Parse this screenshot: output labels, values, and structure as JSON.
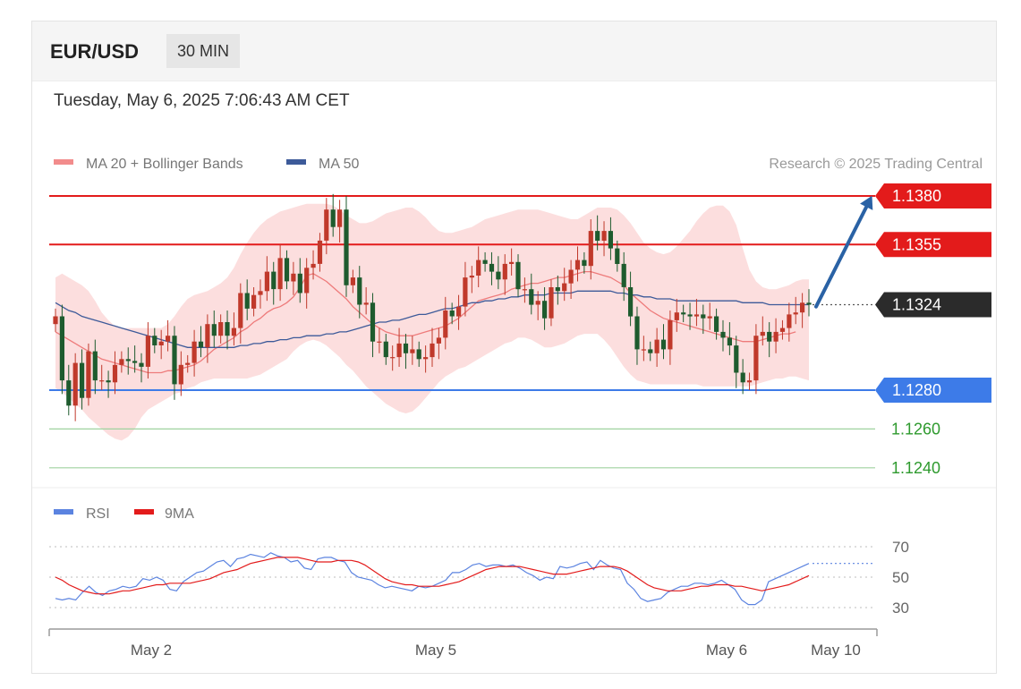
{
  "header": {
    "pair": "EUR/USD",
    "interval": "30 MIN"
  },
  "timestamp": "Tuesday, May 6, 2025 7:06:43 AM CET",
  "legend": {
    "ma20_label": "MA 20 + Bollinger Bands",
    "ma50_label": "MA 50",
    "credit": "Research © 2025 Trading Central",
    "rsi_label": "RSI",
    "ma9_label": "9MA"
  },
  "colors": {
    "bull": "#c0392b",
    "bear": "#1e5b2e",
    "band": "#fbd3d3",
    "ma20": "#ee7b7b",
    "ma50": "#3d5a99",
    "resistance": "#e31b1b",
    "support": "#3d7be8",
    "target": "#2a62a5",
    "current": "#2b2b2b",
    "minor_support": "#2e9a2e",
    "rsi": "#5b83e0",
    "rsi_ma": "#e31b1b"
  },
  "chart_data": [
    {
      "type": "candlestick",
      "y_range": [
        1.1225,
        1.1395
      ],
      "x_ticks": [
        "May 2",
        "May 5",
        "May 6",
        "May 10"
      ],
      "levels": [
        {
          "value": 1.138,
          "label": "1.1380",
          "kind": "resistance"
        },
        {
          "value": 1.1355,
          "label": "1.1355",
          "kind": "resistance"
        },
        {
          "value": 1.1324,
          "label": "1.1324",
          "kind": "current"
        },
        {
          "value": 1.128,
          "label": "1.1280",
          "kind": "support"
        },
        {
          "value": 1.126,
          "label": "1.1260",
          "kind": "minor_support"
        },
        {
          "value": 1.124,
          "label": "1.1240",
          "kind": "minor_support"
        }
      ],
      "forecast": {
        "from": 1.1323,
        "to": 1.1376,
        "direction": "up"
      },
      "close": [
        1.1318,
        1.1285,
        1.1272,
        1.1294,
        1.1276,
        1.13,
        1.1285,
        1.1285,
        1.1284,
        1.1293,
        1.1296,
        1.1295,
        1.1294,
        1.1292,
        1.1308,
        1.1303,
        1.1305,
        1.1308,
        1.1283,
        1.1293,
        1.1294,
        1.1305,
        1.1302,
        1.1314,
        1.1308,
        1.1315,
        1.1308,
        1.1312,
        1.133,
        1.1322,
        1.1329,
        1.1331,
        1.1341,
        1.1332,
        1.1348,
        1.1336,
        1.134,
        1.133,
        1.1343,
        1.1345,
        1.1357,
        1.1373,
        1.1364,
        1.1373,
        1.1334,
        1.1338,
        1.1324,
        1.1325,
        1.1305,
        1.1305,
        1.1297,
        1.1297,
        1.1304,
        1.1299,
        1.1301,
        1.1296,
        1.1297,
        1.1304,
        1.1307,
        1.1321,
        1.1318,
        1.1323,
        1.1338,
        1.1339,
        1.1347,
        1.1345,
        1.1341,
        1.1337,
        1.1345,
        1.1346,
        1.1332,
        1.1332,
        1.1324,
        1.1326,
        1.1317,
        1.1333,
        1.1331,
        1.1335,
        1.1342,
        1.1347,
        1.1344,
        1.1362,
        1.1357,
        1.1362,
        1.1353,
        1.1345,
        1.1333,
        1.1318,
        1.1301,
        1.1301,
        1.1299,
        1.1306,
        1.1301,
        1.1316,
        1.132,
        1.1319,
        1.1318,
        1.1319,
        1.1317,
        1.1318,
        1.131,
        1.1307,
        1.1303,
        1.1289,
        1.1284,
        1.1285,
        1.1308,
        1.131,
        1.1305,
        1.131,
        1.1312,
        1.1319,
        1.132,
        1.1325,
        1.1324
      ],
      "ma20": [
        1.131,
        1.1308,
        1.1306,
        1.1304,
        1.1302,
        1.13,
        1.1298,
        1.1296,
        1.1295,
        1.1294,
        1.1293,
        1.1292,
        1.1291,
        1.129,
        1.1289,
        1.1289,
        1.1289,
        1.129,
        1.129,
        1.1291,
        1.1292,
        1.1293,
        1.1295,
        1.1298,
        1.1301,
        1.1303,
        1.1305,
        1.1307,
        1.131,
        1.1312,
        1.1315,
        1.1317,
        1.132,
        1.1322,
        1.1323,
        1.1325,
        1.1328,
        1.1333,
        1.1339,
        1.134,
        1.1338,
        1.1336,
        1.1333,
        1.133,
        1.1327,
        1.1323,
        1.132,
        1.1317,
        1.1314,
        1.1312,
        1.131,
        1.1309,
        1.1308,
        1.1308,
        1.1308,
        1.1309,
        1.131,
        1.1311,
        1.1312,
        1.1313,
        1.1315,
        1.1317,
        1.132,
        1.1323,
        1.1326,
        1.1327,
        1.1328,
        1.1329,
        1.133,
        1.1332,
        1.1333,
        1.1334,
        1.1335,
        1.1335,
        1.1336,
        1.1337,
        1.1338,
        1.1338,
        1.1339,
        1.134,
        1.1341,
        1.1341,
        1.134,
        1.1339,
        1.1338,
        1.1336,
        1.1334,
        1.133,
        1.1327,
        1.1324,
        1.1321,
        1.1319,
        1.1317,
        1.1316,
        1.1315,
        1.1314,
        1.1313,
        1.1312,
        1.1311,
        1.131,
        1.1309,
        1.1308,
        1.1307,
        1.1306,
        1.1305,
        1.1305,
        1.1305,
        1.1306,
        1.1307,
        1.1308,
        1.1309,
        1.1309,
        1.131
      ],
      "ma50": [
        1.1325,
        1.1323,
        1.1321,
        1.132,
        1.1318,
        1.1317,
        1.1316,
        1.1315,
        1.1314,
        1.1313,
        1.1312,
        1.1311,
        1.131,
        1.1309,
        1.1308,
        1.1307,
        1.1306,
        1.1305,
        1.1304,
        1.1303,
        1.1302,
        1.1302,
        1.1302,
        1.1302,
        1.1302,
        1.1302,
        1.1302,
        1.1302,
        1.1303,
        1.1303,
        1.1304,
        1.1304,
        1.1305,
        1.1305,
        1.1306,
        1.1306,
        1.1307,
        1.1307,
        1.1308,
        1.1308,
        1.1308,
        1.1309,
        1.1309,
        1.131,
        1.131,
        1.1311,
        1.1312,
        1.1313,
        1.1314,
        1.1315,
        1.1315,
        1.1316,
        1.1316,
        1.1317,
        1.1318,
        1.1319,
        1.1319,
        1.132,
        1.1321,
        1.1322,
        1.1322,
        1.1323,
        1.1324,
        1.1325,
        1.1325,
        1.1326,
        1.1326,
        1.1327,
        1.1327,
        1.1328,
        1.1328,
        1.1329,
        1.1329,
        1.1329,
        1.1329,
        1.133,
        1.133,
        1.133,
        1.133,
        1.1331,
        1.1331,
        1.1331,
        1.1331,
        1.1331,
        1.1331,
        1.133,
        1.133,
        1.1329,
        1.1329,
        1.1328,
        1.1328,
        1.1327,
        1.1327,
        1.1327,
        1.1326,
        1.1326,
        1.1326,
        1.1326,
        1.1326,
        1.1326,
        1.1326,
        1.1326,
        1.1326,
        1.1326,
        1.1325,
        1.1325,
        1.1325,
        1.1325,
        1.1324,
        1.1324,
        1.1324,
        1.1324,
        1.1324,
        1.1324,
        1.1324
      ],
      "bb_upper": [
        1.1338,
        1.134,
        1.1338,
        1.1336,
        1.1334,
        1.1331,
        1.1326,
        1.132,
        1.1316,
        1.1313,
        1.1312,
        1.1312,
        1.1312,
        1.1312,
        1.1312,
        1.1312,
        1.1312,
        1.1314,
        1.1318,
        1.1323,
        1.1327,
        1.1329,
        1.133,
        1.1331,
        1.1333,
        1.1335,
        1.1338,
        1.1343,
        1.135,
        1.1356,
        1.1361,
        1.1365,
        1.1368,
        1.137,
        1.1372,
        1.1373,
        1.1374,
        1.1375,
        1.1376,
        1.1376,
        1.1376,
        1.1376,
        1.1375,
        1.1373,
        1.137,
        1.1368,
        1.1366,
        1.1366,
        1.1367,
        1.1369,
        1.1371,
        1.1372,
        1.1373,
        1.1374,
        1.1374,
        1.1372,
        1.1369,
        1.1365,
        1.1362,
        1.1361,
        1.1361,
        1.1362,
        1.1363,
        1.1364,
        1.1366,
        1.1368,
        1.1369,
        1.137,
        1.1371,
        1.1372,
        1.1373,
        1.1373,
        1.1373,
        1.1373,
        1.1372,
        1.1371,
        1.137,
        1.1369,
        1.1368,
        1.1368,
        1.137,
        1.1372,
        1.1374,
        1.1374,
        1.1374,
        1.1373,
        1.137,
        1.1366,
        1.1361,
        1.1356,
        1.1353,
        1.1351,
        1.135,
        1.1351,
        1.1354,
        1.1358,
        1.1362,
        1.1367,
        1.1371,
        1.1374,
        1.1375,
        1.1375,
        1.1372,
        1.1365,
        1.1353,
        1.1342,
        1.1336,
        1.1333,
        1.1332,
        1.1332,
        1.1333,
        1.1334,
        1.1336,
        1.1337,
        1.1337
      ],
      "bb_lower": [
        1.1281,
        1.1279,
        1.1276,
        1.1273,
        1.127,
        1.1266,
        1.1263,
        1.126,
        1.1257,
        1.1255,
        1.1254,
        1.1256,
        1.126,
        1.1266,
        1.127,
        1.1272,
        1.1274,
        1.1276,
        1.1278,
        1.1279,
        1.1281,
        1.1282,
        1.1284,
        1.1285,
        1.1286,
        1.1286,
        1.1286,
        1.1286,
        1.1286,
        1.1286,
        1.1287,
        1.1288,
        1.129,
        1.1292,
        1.1294,
        1.1296,
        1.13,
        1.1303,
        1.1305,
        1.1306,
        1.1305,
        1.1303,
        1.13,
        1.1297,
        1.1293,
        1.129,
        1.1286,
        1.1282,
        1.1279,
        1.1276,
        1.1273,
        1.1271,
        1.1269,
        1.1268,
        1.1269,
        1.1272,
        1.1276,
        1.128,
        1.1284,
        1.1287,
        1.1289,
        1.1291,
        1.1292,
        1.1294,
        1.1296,
        1.1298,
        1.13,
        1.1302,
        1.1304,
        1.1305,
        1.1307,
        1.1307,
        1.1306,
        1.1304,
        1.1302,
        1.1302,
        1.1303,
        1.1304,
        1.1306,
        1.1308,
        1.1309,
        1.1309,
        1.1309,
        1.1306,
        1.1302,
        1.1297,
        1.1292,
        1.1288,
        1.1285,
        1.1284,
        1.1283,
        1.1283,
        1.1283,
        1.1283,
        1.1283,
        1.1283,
        1.1283,
        1.1283,
        1.1282,
        1.1282,
        1.1282,
        1.1282,
        1.1282,
        1.1282,
        1.1282,
        1.1282,
        1.1283,
        1.1284,
        1.1285,
        1.1286,
        1.1286,
        1.1287,
        1.1287,
        1.1286,
        1.1285
      ]
    },
    {
      "type": "line",
      "y_range": [
        20,
        80
      ],
      "y_ticks": [
        70,
        50,
        30
      ],
      "series": [
        {
          "name": "RSI",
          "values": [
            36,
            35,
            36,
            35,
            40,
            44,
            40,
            38,
            41,
            42,
            44,
            43,
            44,
            49,
            48,
            50,
            48,
            42,
            41,
            47,
            50,
            53,
            54,
            57,
            60,
            61,
            57,
            62,
            63,
            65,
            64,
            63,
            66,
            64,
            63,
            60,
            61,
            56,
            55,
            62,
            63,
            63,
            61,
            60,
            53,
            50,
            49,
            48,
            45,
            43,
            44,
            43,
            42,
            41,
            44,
            43,
            44,
            46,
            48,
            53,
            53,
            55,
            58,
            59,
            57,
            58,
            58,
            57,
            58,
            56,
            53,
            51,
            48,
            50,
            49,
            57,
            56,
            57,
            59,
            60,
            55,
            61,
            58,
            56,
            55,
            46,
            42,
            36,
            34,
            35,
            36,
            40,
            42,
            44,
            44,
            46,
            46,
            45,
            46,
            48,
            45,
            42,
            35,
            32,
            32,
            35,
            47,
            49,
            51,
            53,
            55,
            57,
            59
          ]
        },
        {
          "name": "9MA",
          "values": [
            50,
            48,
            45,
            43,
            41,
            40,
            39,
            39,
            39,
            40,
            41,
            41,
            42,
            43,
            44,
            45,
            45,
            46,
            46,
            46,
            46,
            47,
            48,
            49,
            51,
            53,
            54,
            55,
            57,
            59,
            60,
            61,
            62,
            63,
            63,
            63,
            63,
            62,
            61,
            60,
            60,
            60,
            61,
            61,
            61,
            60,
            58,
            55,
            52,
            49,
            47,
            46,
            45,
            45,
            44,
            44,
            44,
            44,
            45,
            46,
            47,
            49,
            51,
            53,
            55,
            56,
            57,
            57,
            57,
            57,
            56,
            55,
            54,
            53,
            52,
            52,
            52,
            53,
            54,
            55,
            56,
            57,
            57,
            57,
            56,
            54,
            51,
            48,
            45,
            43,
            42,
            41,
            41,
            41,
            42,
            43,
            44,
            44,
            45,
            45,
            45,
            44,
            44,
            43,
            42,
            41,
            42,
            43,
            44,
            45,
            47,
            49,
            51
          ]
        }
      ]
    }
  ]
}
